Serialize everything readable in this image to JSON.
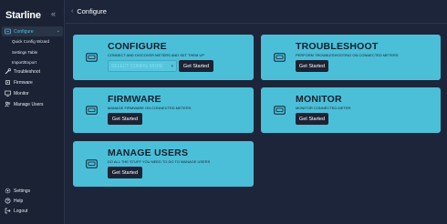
{
  "sidebar": {
    "logo": "Starline",
    "collapse_icon": "double-chevron-left-icon",
    "items": [
      {
        "label": "Configure",
        "icon": "sliders-icon",
        "active": true
      },
      {
        "label": "Troubleshoot",
        "icon": "wrench-icon"
      },
      {
        "label": "Firmware",
        "icon": "chip-icon"
      },
      {
        "label": "Monitor",
        "icon": "monitor-icon"
      },
      {
        "label": "Manage Users",
        "icon": "users-icon"
      }
    ],
    "sub_items": [
      "Quick Config Wizard",
      "Settings Table",
      "Import/Export"
    ],
    "bottom_items": [
      {
        "label": "Settings",
        "icon": "gear-icon"
      },
      {
        "label": "Help",
        "icon": "help-icon"
      },
      {
        "label": "Logout",
        "icon": "logout-icon"
      }
    ]
  },
  "header": {
    "back_icon": "chevron-left-icon",
    "title": "Configure"
  },
  "cards": {
    "configure": {
      "title": "CONFIGURE",
      "desc": "CONNECT AND DISCOVER METERS AND SET THEM UP",
      "select_placeholder": "SELECT CONFIG MODE",
      "button": "Get Started"
    },
    "troubleshoot": {
      "title": "TROUBLESHOOT",
      "desc": "PERFORM TROUBLESHOOTING ON CONNECTED METERS",
      "button": "Get Started"
    },
    "firmware": {
      "title": "FIRMWARE",
      "desc": "MANAGE FIRMWARE ON CONNECTED METERS",
      "button": "Get Started"
    },
    "monitor": {
      "title": "MONITOR",
      "desc": "MONITOR CONNECTED METER",
      "button": "Get Started"
    },
    "manage_users": {
      "title": "MANAGE USERS",
      "desc": "DO ALL THE STUFF YOU NEED TO DO TO MANAGE USERS",
      "button": "Get Started"
    }
  },
  "colors": {
    "accent": "#4bbfd8",
    "background": "#1c2539",
    "sidebar": "#1a2233",
    "button": "#1b2335"
  }
}
